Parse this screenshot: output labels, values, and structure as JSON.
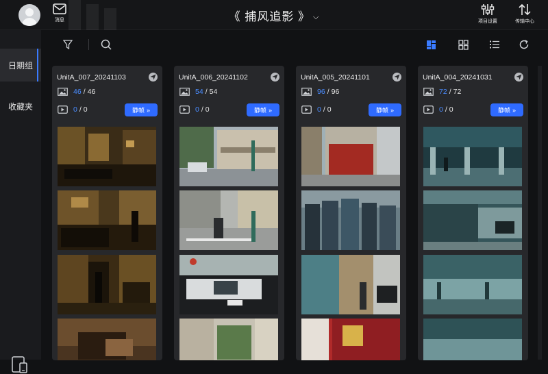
{
  "topbar": {
    "messages_label": "消息",
    "title": "《 捕风追影 》",
    "project_settings_label": "项目设置",
    "transfer_center_label": "传输中心"
  },
  "sidebar": {
    "items": [
      {
        "label": "日期组",
        "active": true
      },
      {
        "label": "收藏夹",
        "active": false
      }
    ]
  },
  "colors": {
    "accent": "#2f6bff",
    "count_blue": "#4a8cff"
  },
  "cards": [
    {
      "title": "UnitA_007_20241103",
      "images_count": "46",
      "images_total": "46",
      "videos_count": "0",
      "videos_total": "0",
      "still_label": "静帧",
      "thumbnails": [
        "night-alley-bikes",
        "night-street-man",
        "night-doorway-man",
        "sleeping-man-closeup"
      ]
    },
    {
      "title": "UnitA_006_20241102",
      "images_count": "54",
      "images_total": "54",
      "videos_count": "0",
      "videos_total": "0",
      "still_label": "静帧",
      "thumbnails": [
        "street-corner-car",
        "crosswalk-scooter",
        "taxi-closeup",
        "tree-building"
      ]
    },
    {
      "title": "UnitA_005_20241101",
      "images_count": "96",
      "images_total": "96",
      "videos_count": "0",
      "videos_total": "0",
      "still_label": "静帧",
      "thumbnails": [
        "red-building-corner",
        "group-of-men-walking",
        "tryangle-street",
        "toy-shop"
      ]
    },
    {
      "title": "UnitA_004_20241031",
      "images_count": "72",
      "images_total": "72",
      "videos_count": "0",
      "videos_total": "0",
      "still_label": "静帧",
      "thumbnails": [
        "terminal-interior",
        "terminal-outside",
        "terminal-ceiling",
        "terminal-wide"
      ]
    }
  ]
}
